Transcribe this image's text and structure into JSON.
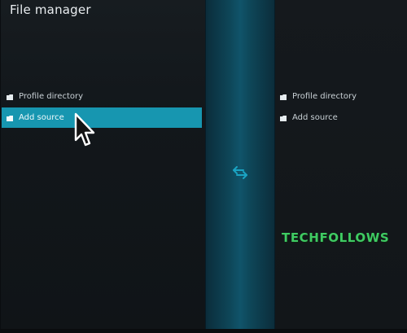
{
  "window": {
    "title": "File manager"
  },
  "left_pane": {
    "items": [
      {
        "label": "Profile directory",
        "icon": "folder-icon"
      },
      {
        "label": "Add source",
        "icon": "folder-icon",
        "selected": true
      }
    ]
  },
  "right_pane": {
    "items": [
      {
        "label": "Profile directory",
        "icon": "folder-icon"
      },
      {
        "label": "Add source",
        "icon": "folder-icon"
      }
    ]
  },
  "swap_button": {
    "icon": "swap-arrows-icon"
  },
  "watermark": {
    "text": "TECHFOLLOWS"
  },
  "colors": {
    "accent": "#1796b0",
    "divider": "#10546a",
    "watermark": "#3fcb63"
  }
}
